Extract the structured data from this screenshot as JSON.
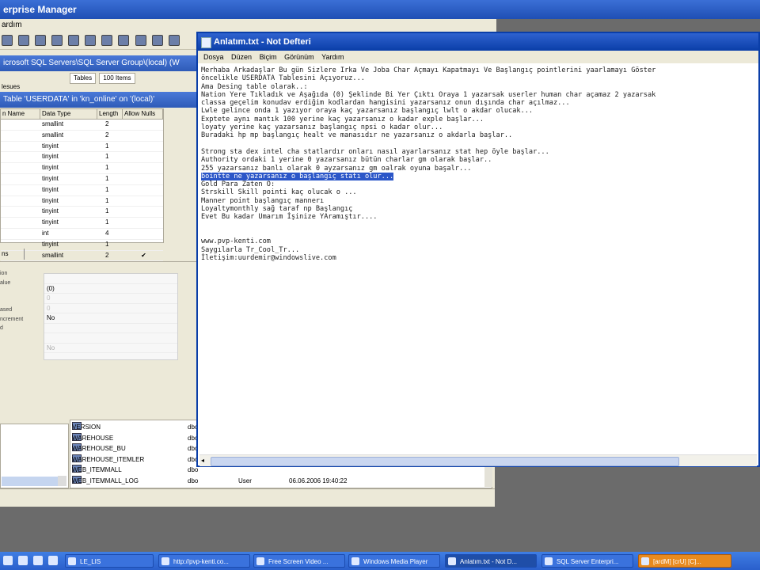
{
  "em": {
    "title": "erprise Manager",
    "menu": "ardım",
    "path": "icrosoft SQL Servers\\SQL Server Group\\(local) (W",
    "tabs": [
      "Tables",
      "100 Items"
    ],
    "users_label": "lesues",
    "design_title": "Table 'USERDATA' in 'kn_online' on '(local)'",
    "grid_headers": [
      "n Name",
      "Data Type",
      "Length",
      "Allow Nulls"
    ],
    "grid_rows": [
      {
        "type": "smallint",
        "len": "2",
        "nulls": ""
      },
      {
        "type": "smallint",
        "len": "2",
        "nulls": ""
      },
      {
        "type": "tinyint",
        "len": "1",
        "nulls": ""
      },
      {
        "type": "tinyint",
        "len": "1",
        "nulls": ""
      },
      {
        "type": "tinyint",
        "len": "1",
        "nulls": ""
      },
      {
        "type": "tinyint",
        "len": "1",
        "nulls": ""
      },
      {
        "type": "tinyint",
        "len": "1",
        "nulls": ""
      },
      {
        "type": "tinyint",
        "len": "1",
        "nulls": ""
      },
      {
        "type": "tinyint",
        "len": "1",
        "nulls": ""
      },
      {
        "type": "tinyint",
        "len": "1",
        "nulls": ""
      },
      {
        "type": "int",
        "len": "4",
        "nulls": ""
      },
      {
        "type": "tinyint",
        "len": "1",
        "nulls": ""
      },
      {
        "type": "smallint",
        "len": "2",
        "nulls": "✔"
      }
    ],
    "props_tab": "ns",
    "props_left": [
      "ion",
      "alue",
      "",
      "",
      "ased",
      "ncrement",
      "d"
    ],
    "props_values": [
      "",
      "(0)",
      "0",
      "0",
      "No",
      "",
      "",
      "No"
    ],
    "objects": [
      {
        "name": "VERSION",
        "owner": "dbo",
        "type": "",
        "date": ""
      },
      {
        "name": "WAREHOUSE",
        "owner": "dbo",
        "type": "",
        "date": ""
      },
      {
        "name": "WAREHOUSE_BU",
        "owner": "dbo",
        "type": "",
        "date": ""
      },
      {
        "name": "WAREHOUSE_ITEMLER",
        "owner": "dbo",
        "type": "",
        "date": ""
      },
      {
        "name": "WEB_ITEMMALL",
        "owner": "dbo",
        "type": "",
        "date": ""
      },
      {
        "name": "WEB_ITEMMALL_LOG",
        "owner": "dbo",
        "type": "User",
        "date": "06.06.2006 19:40:22"
      }
    ]
  },
  "notepad": {
    "title": "Anlatım.txt - Not Defteri",
    "menu": [
      "Dosya",
      "Düzen",
      "Biçim",
      "Görünüm",
      "Yardım"
    ],
    "lines": [
      "Merhaba Arkadaşlar Bu gün Sizlere Irka Ve Joba Char Açmayı Kapatmayı Ve Başlangıç pointlerini yaarlamayı Göster",
      "öncelikle USERDATA Tablesini Açıyoruz...",
      "Ama Desing table olarak..:",
      "Nation Yere Tıkladık ve Aşağıda (0) Şeklinde Bi Yer Çıktı Oraya 1 yazarsak userler human char açamaz 2 yazarsak",
      "classa geçelim konudav erdiğim kodlardan hangisini yazarsanız onun dışında char açılmaz...",
      "Lwle gelince onda 1 yazıyor oraya kaç yazarsanız başlangıç lwlt o akdar olucak...",
      "Exptete aynı mantık 100 yerine kaç yazarsanız o kadar exple başlar...",
      "loyaty yerine kaç yazarsanız başlangıç npsi o kadar olur...",
      "Buradaki hp mp başlangıç healt ve manasıdır ne yazarsanız o akdarla başlar..",
      "",
      "Strong sta dex intel cha statlardır onları nasıl ayarlarsanız stat hep öyle başlar...",
      "Authority ordaki 1 yerine 0 yazarsanız bütün charlar gm olarak başlar..",
      "255 yazarsanız banlı olarak 0 ayzarsanız gm oalrak oyuna başalr...",
      "bointte ne yazarsanız o başlangıç statı olur...",
      "Gold Para Zaten O:",
      "Strskill Skill pointi kaç olucak o ...",
      "Manner point başlangıç mannerı",
      "Loyaltymonthly sağ taraf np Başlangıç",
      "Evet Bu kadar Umarım İşinize YAramıştır....",
      "",
      "",
      "www.pvp-kenti.com",
      "Saygılarla Tr_Cool_Tr...",
      "İletişim:uurdemir@windowslive.com"
    ],
    "selected_line": 13
  },
  "taskbar": {
    "items": [
      "LE_LIS",
      "http://pvp-kenti.co...",
      "Free Screen Video ...",
      "Windows Media Player",
      "Anlatım.txt - Not D...",
      "SQL Server Enterpri...",
      "[ardM] [crU] [C]..."
    ]
  }
}
